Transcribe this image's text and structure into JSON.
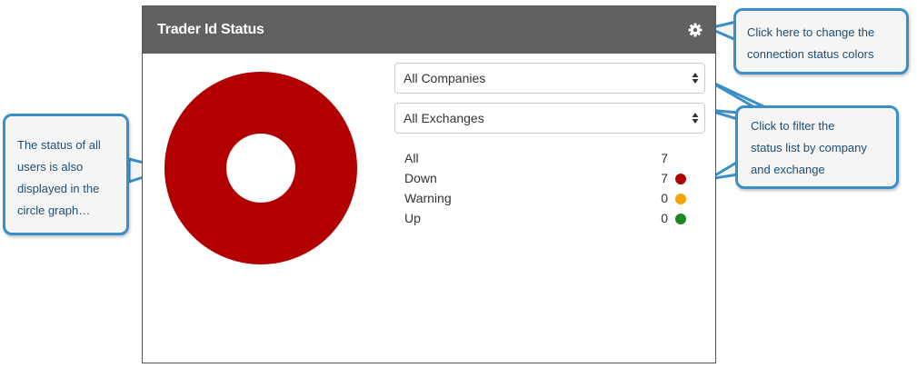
{
  "panel": {
    "title": "Trader Id Status",
    "settings_icon": "gear-icon"
  },
  "filters": {
    "company": {
      "selected": "All Companies"
    },
    "exchange": {
      "selected": "All Exchanges"
    }
  },
  "donut": {
    "segments": [
      {
        "status": "Down",
        "value": 7,
        "color": "#b20000"
      },
      {
        "status": "Warning",
        "value": 0,
        "color": "#f5a300"
      },
      {
        "status": "Up",
        "value": 0,
        "color": "#1a8a1a"
      }
    ]
  },
  "status_list": [
    {
      "label": "All",
      "count": "7",
      "color": ""
    },
    {
      "label": "Down",
      "count": "7",
      "color": "#b20000"
    },
    {
      "label": "Warning",
      "count": "0",
      "color": "#f5a300"
    },
    {
      "label": "Up",
      "count": "0",
      "color": "#1a8a1a"
    }
  ],
  "callouts": {
    "colors": [
      "Click here to change the",
      "connection status colors"
    ],
    "filter": [
      "Click to filter the",
      "status list by company",
      "and exchange"
    ],
    "graph": [
      "The status of all",
      "users is also",
      "displayed in the",
      "circle graph…"
    ]
  }
}
